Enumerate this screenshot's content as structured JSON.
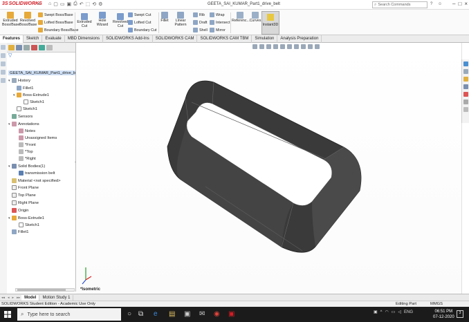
{
  "titlebar": {
    "logo_text": "SOLIDWORKS",
    "doc_title": "GEETA_SAI_KUMAR_Part1_drive_belt",
    "search_placeholder": "Search Commands"
  },
  "command_manager": {
    "extruded_boss": [
      "Extruded",
      "Boss/Base"
    ],
    "revolved_boss": [
      "Revolved",
      "Boss/Base"
    ],
    "swept_boss": "Swept Boss/Base",
    "lofted_boss": "Lofted Boss/Base",
    "boundary_boss": "Boundary Boss/Base",
    "extruded_cut": [
      "Extruded",
      "Cut"
    ],
    "hole_wizard": "Hole Wizard",
    "revolved_cut": [
      "Revolved",
      "Cut"
    ],
    "swept_cut": "Swept Cut",
    "lofted_cut": "Lofted Cut",
    "boundary_cut": "Boundary Cut",
    "fillet": "Fillet",
    "linear_pattern": "Linear Pattern",
    "rib": "Rib",
    "draft": "Draft",
    "shell": "Shell",
    "wrap": "Wrap",
    "intersect": "Intersect",
    "mirror": "Mirror",
    "reference": "Referenc...",
    "curves": "Curves",
    "instant3d": "Instant3D"
  },
  "tabs": [
    "Features",
    "Sketch",
    "Evaluate",
    "MBD Dimensions",
    "SOLIDWORKS Add-Ins",
    "SOLIDWORKS CAM",
    "SOLIDWORKS CAM TBM",
    "Simulation",
    "Analysis Preparation"
  ],
  "tree": {
    "root": "GEETA_SAI_KUMAR_Part1_drive_b",
    "items": [
      "History",
      "Fillet1",
      "Boss-Extrude1",
      "Sketch1",
      "Sketch1",
      "Sensors",
      "Annotations",
      "Notes",
      "Unassigned Items",
      "*Front",
      "*Top",
      "*Right",
      "Solid Bodies(1)",
      "transmission belt",
      "Material <not specified>",
      "Front Plane",
      "Top Plane",
      "Right Plane",
      "Origin",
      "Boss-Extrude1",
      "Sketch1",
      "Fillet1"
    ]
  },
  "viewport": {
    "view_name": "*Isometric"
  },
  "model_tabs": [
    "Model",
    "Motion Study 1"
  ],
  "status": {
    "edition": "SOLIDWORKS Student Edition - Academic Use Only",
    "mode": "Editing Part",
    "units": "MMGS"
  },
  "taskbar": {
    "search_text": "Type here to search",
    "lang": "ENG",
    "time": "06:51 PM",
    "date": "07-12-2020",
    "notifications": "3"
  },
  "colors": {
    "accent_blue": "#1e63c0",
    "solidworks_red": "#d41d25",
    "belt_dark": "#3a3a3a",
    "taskbar": "#1b1b1b"
  }
}
